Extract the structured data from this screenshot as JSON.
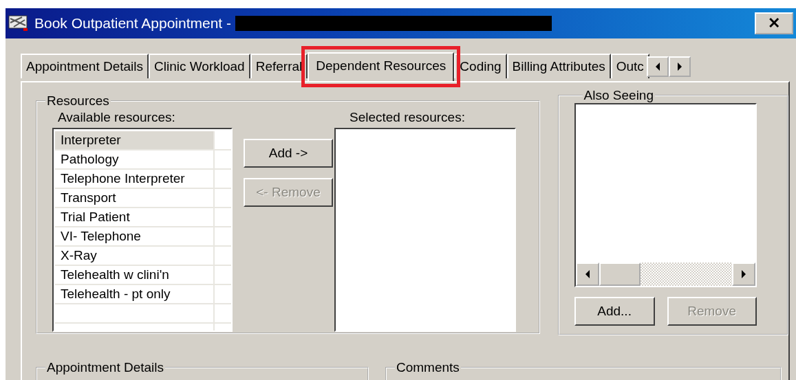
{
  "window": {
    "title": "Book Outpatient Appointment -",
    "close": "✕"
  },
  "tabs": [
    {
      "label": "Appointment Details",
      "selected": false,
      "highlighted": false
    },
    {
      "label": "Clinic Workload",
      "selected": false,
      "highlighted": false
    },
    {
      "label": "Referral",
      "selected": false,
      "highlighted": false
    },
    {
      "label": "Dependent Resources",
      "selected": true,
      "highlighted": true
    },
    {
      "label": "Coding",
      "selected": false,
      "highlighted": false
    },
    {
      "label": "Billing Attributes",
      "selected": false,
      "highlighted": false
    },
    {
      "label": "Outc",
      "selected": false,
      "highlighted": false
    }
  ],
  "resources": {
    "title": "Resources",
    "available_label": "Available resources:",
    "selected_label": "Selected resources:",
    "available": [
      {
        "label": "Interpreter",
        "selected": true
      },
      {
        "label": "Pathology",
        "selected": false
      },
      {
        "label": "Telephone Interpreter",
        "selected": false
      },
      {
        "label": "Transport",
        "selected": false
      },
      {
        "label": "Trial Patient",
        "selected": false
      },
      {
        "label": "VI- Telephone",
        "selected": false
      },
      {
        "label": "X-Ray",
        "selected": false
      },
      {
        "label": "Telehealth w clini'n",
        "selected": false
      },
      {
        "label": "Telehealth - pt only",
        "selected": false
      }
    ],
    "buttons": [
      {
        "label": "Add ->",
        "disabled": false
      },
      {
        "label": "<- Remove",
        "disabled": true
      }
    ]
  },
  "also_seeing": {
    "title": "Also Seeing",
    "buttons": [
      {
        "label": "Add...",
        "disabled": false
      },
      {
        "label": "Remove",
        "disabled": true
      }
    ]
  },
  "bottom_groups": [
    "Appointment Details",
    "Comments"
  ]
}
